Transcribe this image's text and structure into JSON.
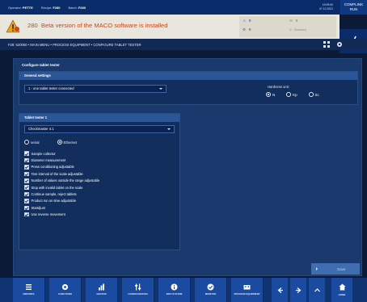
{
  "topbar": {
    "operator_label": "Operator:",
    "operator_value": "PETTE",
    "recipe_label": "Recipe:",
    "recipe_value": "F280",
    "batch_label": "Batch:",
    "batch_value": "F280",
    "time": "15:09:00",
    "date": "07.12.2021",
    "complink_line1": "COMPLINK",
    "complink_line2": "RUN"
  },
  "warning": {
    "code": "280",
    "message": "Beta version of the MACO software is installed",
    "status_a": "0",
    "status_b": "0",
    "status_c": "0",
    "status_d": "Summary"
  },
  "breadcrumb": {
    "path": "F28: 520050 • MAIN MENU • PROCESS EQUIPMENT • CONFIGURE TABLET TESTER"
  },
  "panel": {
    "title": "Configure tablet tester",
    "general": {
      "header": "General settings",
      "mode_value": "1 - one tablet tester connected",
      "hardness_label": "Hardness unit:",
      "hardness_options": [
        "N",
        "Kp",
        "Sc"
      ],
      "hardness_selected": "N"
    },
    "tester": {
      "header": "Tablet tester 1",
      "model_value": "Checkmaster 4.1",
      "connection_options": [
        "serial",
        "Ethernet"
      ],
      "connection_selected": "Ethernet",
      "options": [
        {
          "label": "Sample collector",
          "checked": true
        },
        {
          "label": "Diameter measurement",
          "checked": true
        },
        {
          "label": "Press conditioning adjustable",
          "checked": true
        },
        {
          "label": "Tare interval of the scale adjustable",
          "checked": true
        },
        {
          "label": "Number of values outside the range adjustable",
          "checked": true
        },
        {
          "label": "Stop with invalid tablet on the scale",
          "checked": true
        },
        {
          "label": "Continue sample, reject tablets",
          "checked": true
        },
        {
          "label": "Product run on time adjustable",
          "checked": true
        },
        {
          "label": "Startdjust",
          "checked": true
        },
        {
          "label": "Use reverse movement",
          "checked": true
        }
      ]
    },
    "save_label": "Save"
  },
  "nav": {
    "items": [
      {
        "label": "REPORTS",
        "icon": "reports-icon"
      },
      {
        "label": "FUNCTIONS",
        "icon": "gear-icon"
      },
      {
        "label": "GRAPHS",
        "icon": "bar-chart-icon"
      },
      {
        "label": "CONFIGURATION",
        "icon": "sliders-icon"
      },
      {
        "label": "INFO SYSTEM",
        "icon": "info-icon"
      },
      {
        "label": "MONITOR",
        "icon": "check-circle-icon"
      },
      {
        "label": "PROCESS EQUIPMENT",
        "icon": "equipment-icon"
      }
    ],
    "home_label": "HOME"
  },
  "colors": {
    "header_blue": "#0a2c6a",
    "warning_bg": "#e9e6de",
    "warning_text": "#d24516",
    "panel_bg": "#1a3a6e",
    "nav_button": "#1b4ba0"
  }
}
